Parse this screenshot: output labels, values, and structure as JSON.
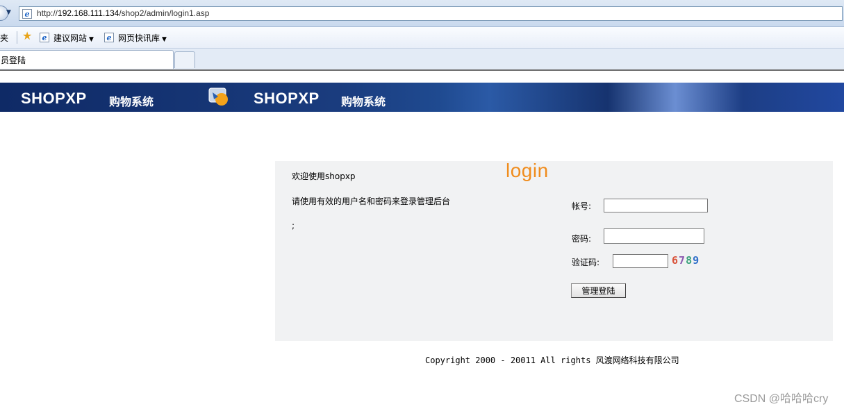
{
  "browser": {
    "url": "http://192.168.111.134/shop2/admin/login1.asp",
    "url_scheme": "http://",
    "url_host": "192.168.111.134",
    "url_path": "/shop2/admin/login1.asp",
    "favorites_label_partial": "夹",
    "favorites": [
      {
        "label": "建议网站"
      },
      {
        "label": "网页快讯库"
      }
    ],
    "tab_title": "员登陆"
  },
  "banner": {
    "brand_1": "SHOPXP",
    "sub_1": "购物系统",
    "brand_2": "SHOPXP",
    "sub_2": "购物系统"
  },
  "login": {
    "title": "login",
    "welcome": "欢迎使用shopxp",
    "instruction": "请使用有效的用户名和密码来登录管理后台",
    "note": ";",
    "username_label": "帐号:",
    "username_value": "",
    "password_label": "密码:",
    "password_value": "",
    "captcha_label": "验证码:",
    "captcha_value": "",
    "captcha_code": [
      "6",
      "7",
      "8",
      "9"
    ],
    "submit_label": "管理登陆"
  },
  "footer": {
    "copyright": "Copyright 2000 - 20011 All rights 风渡网络科技有限公司"
  },
  "watermark": "CSDN @哈哈哈cry",
  "colors": {
    "login_title": "#f08c1c",
    "banner_dark": "#0f2a66",
    "panel_bg": "#f1f2f3"
  }
}
